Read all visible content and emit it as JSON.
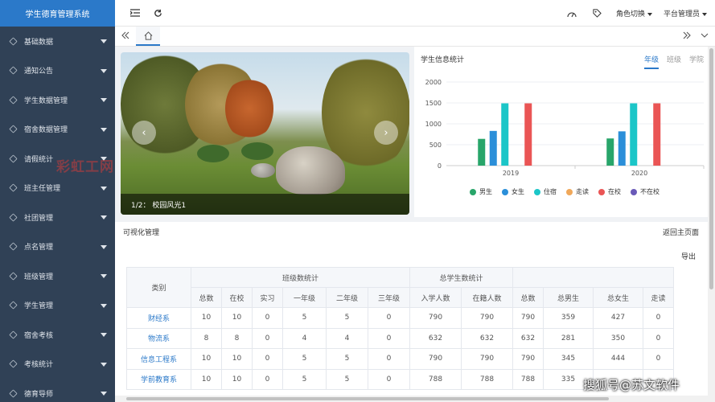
{
  "app": {
    "title": "学生德育管理系统"
  },
  "sidebar": {
    "items": [
      {
        "label": "基础数据"
      },
      {
        "label": "通知公告"
      },
      {
        "label": "学生数据管理"
      },
      {
        "label": "宿舍数据管理"
      },
      {
        "label": "请假统计"
      },
      {
        "label": "班主任管理"
      },
      {
        "label": "社团管理"
      },
      {
        "label": "点名管理"
      },
      {
        "label": "班级管理"
      },
      {
        "label": "学生管理"
      },
      {
        "label": "宿舍考核"
      },
      {
        "label": "考核统计"
      },
      {
        "label": "德育导师"
      }
    ]
  },
  "topbar": {
    "role_switch": "角色切换",
    "user": "平台管理员"
  },
  "carousel": {
    "caption": "1/2： 校园风光1",
    "watermark": "彩虹工网"
  },
  "stats_panel": {
    "title": "学生信息统计",
    "tabs": [
      "年级",
      "班级",
      "学院"
    ]
  },
  "chart_data": {
    "type": "bar",
    "categories": [
      "2019",
      "2020"
    ],
    "ylim": [
      0,
      2000
    ],
    "yticks": [
      0,
      500,
      1000,
      1500,
      2000
    ],
    "series": [
      {
        "name": "男生",
        "color": "#28a56a",
        "values": [
          640,
          650
        ]
      },
      {
        "name": "女生",
        "color": "#2b8fd9",
        "values": [
          830,
          820
        ]
      },
      {
        "name": "住宿",
        "color": "#1cc6c8",
        "values": [
          1490,
          1490
        ]
      },
      {
        "name": "走读",
        "color": "#f0a85a",
        "values": [
          0,
          0
        ]
      },
      {
        "name": "在校",
        "color": "#ea5555",
        "values": [
          1490,
          1490
        ]
      },
      {
        "name": "不在校",
        "color": "#6a5ab8",
        "values": [
          0,
          0
        ]
      }
    ]
  },
  "section": {
    "title": "可视化管理",
    "back": "返回主页面",
    "export": "导出"
  },
  "table": {
    "group_headers": {
      "category": "类别",
      "class_stats": "班级数统计",
      "student_stats": "总学生数统计"
    },
    "columns": [
      "总数",
      "在校",
      "实习",
      "一年级",
      "二年级",
      "三年级",
      "入学人数",
      "在籍人数",
      "总数",
      "总男生",
      "总女生",
      "走读"
    ],
    "rows": [
      {
        "cat": "财经系",
        "cells": [
          "10",
          "10",
          "0",
          "5",
          "5",
          "0",
          "790",
          "790",
          "790",
          "359",
          "427",
          "0"
        ]
      },
      {
        "cat": "物流系",
        "cells": [
          "8",
          "8",
          "0",
          "4",
          "4",
          "0",
          "632",
          "632",
          "632",
          "281",
          "350",
          "0"
        ]
      },
      {
        "cat": "信息工程系",
        "cells": [
          "10",
          "10",
          "0",
          "5",
          "5",
          "0",
          "790",
          "790",
          "790",
          "345",
          "444",
          "0"
        ]
      },
      {
        "cat": "学前教育系",
        "cells": [
          "10",
          "10",
          "0",
          "5",
          "5",
          "0",
          "788",
          "788",
          "788",
          "335",
          "",
          ""
        ]
      }
    ]
  },
  "watermark_bottom": "搜狐号@苏文软件"
}
